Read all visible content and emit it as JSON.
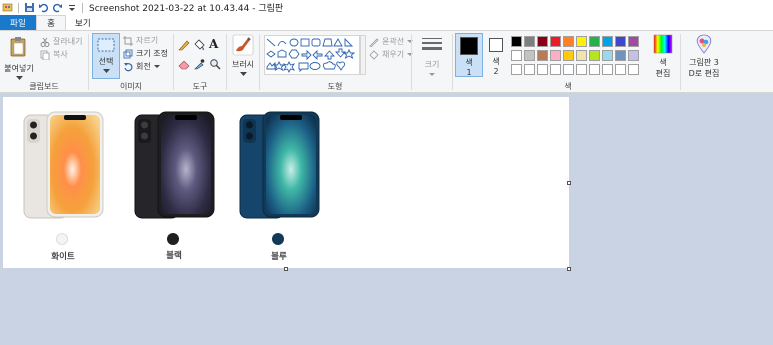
{
  "window": {
    "title": "Screenshot 2021-03-22 at 10.43.44 - 그림판"
  },
  "tabs": [
    {
      "label": "파일"
    },
    {
      "label": "홈"
    },
    {
      "label": "보기"
    }
  ],
  "clipboard": {
    "paste": "붙여넣기",
    "cut": "잘라내기",
    "copy": "복사",
    "group": "클립보드"
  },
  "image": {
    "select": "선택",
    "crop": "자르기",
    "resize": "크기 조정",
    "rotate": "회전",
    "group": "이미지"
  },
  "tools": {
    "group": "도구",
    "brushes": "브러시"
  },
  "shapes": {
    "outline": "윤곽선",
    "fill": "채우기",
    "group": "도형"
  },
  "size": {
    "label": "크기"
  },
  "colors": {
    "color1": "색",
    "color1_num": "1",
    "color2": "색",
    "color2_num": "2",
    "edit": "색\n편집",
    "edit_line1": "색",
    "edit_line2": "편집",
    "paint3d_line1": "그림판 3",
    "paint3d_line2": "D로 편집",
    "group": "색",
    "color1_value": "#000000",
    "color2_value": "#ffffff",
    "palette_row1": [
      "#000000",
      "#7f7f7f",
      "#880015",
      "#ed1c24",
      "#ff7f27",
      "#fff200",
      "#22b14c",
      "#00a2e8",
      "#3f48cc",
      "#a349a4"
    ],
    "palette_row2": [
      "#ffffff",
      "#c3c3c3",
      "#b97a57",
      "#ffaec9",
      "#ffc90e",
      "#efe4b0",
      "#b5e61d",
      "#99d9ea",
      "#7092be",
      "#c8bfe7"
    ]
  },
  "canvas_content": {
    "variants": [
      {
        "label": "화이트",
        "dot_color": "#f4f4f4"
      },
      {
        "label": "블랙",
        "dot_color": "#1f1f22"
      },
      {
        "label": "블루",
        "dot_color": "#123a57"
      }
    ]
  }
}
